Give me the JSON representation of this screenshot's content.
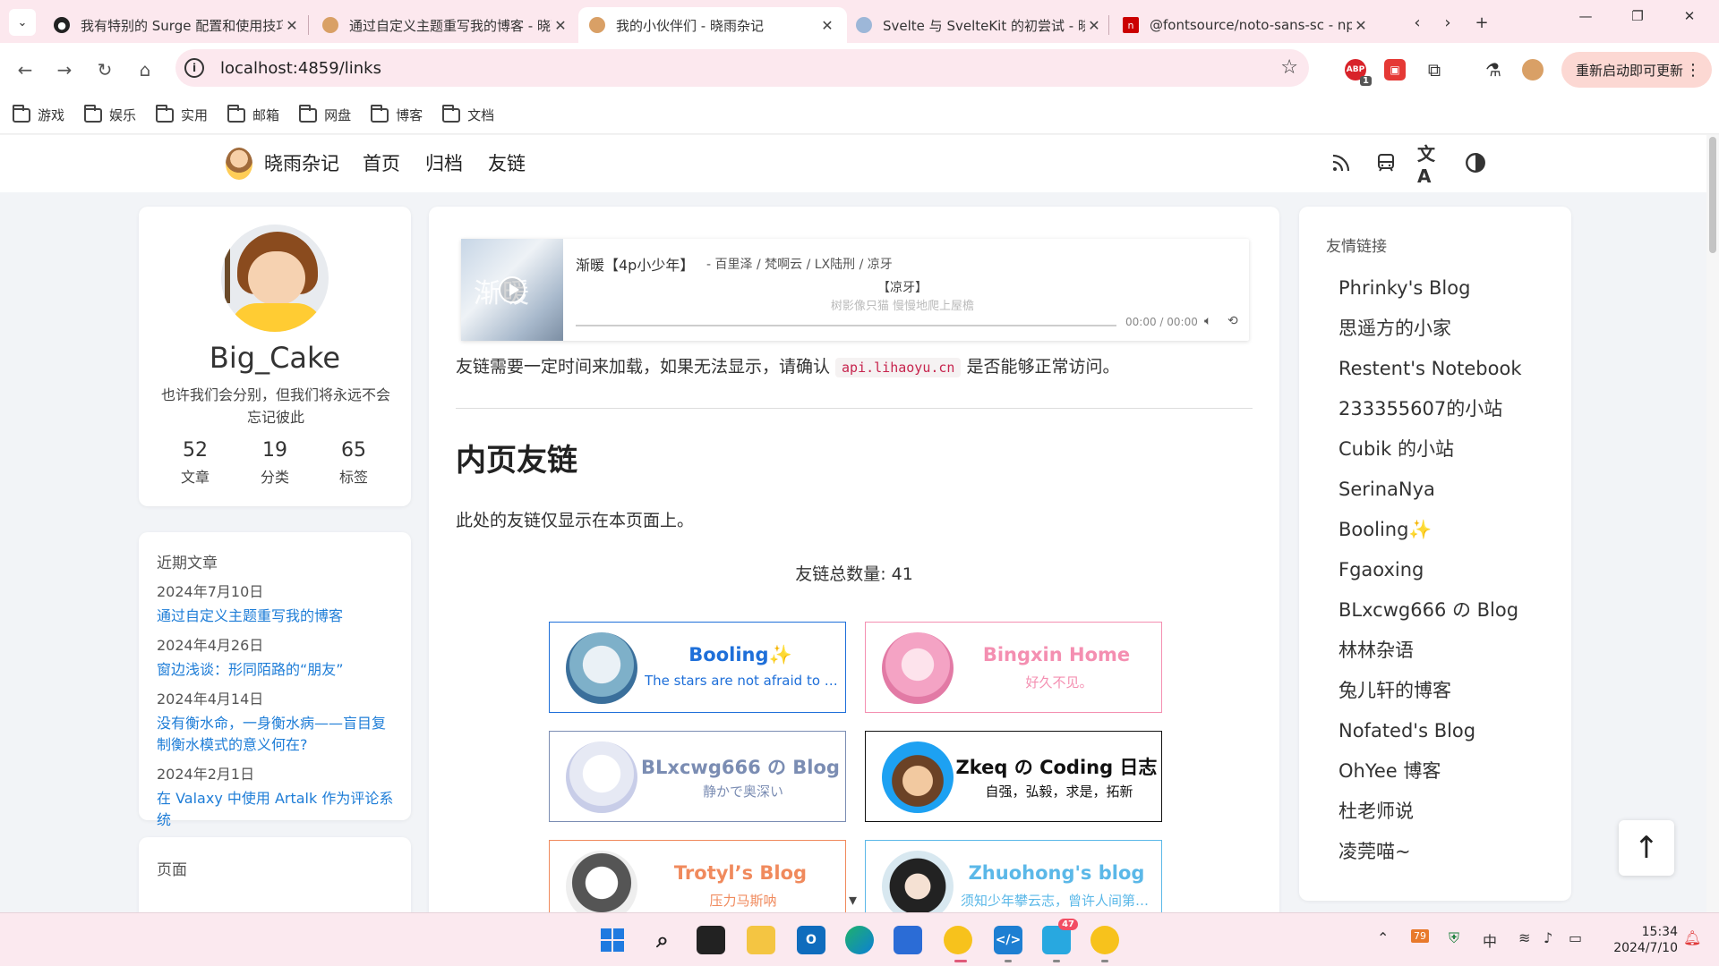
{
  "browser": {
    "tabs": [
      {
        "title": "我有特别的 Surge 配置和使用技巧",
        "fav_color": "#222222"
      },
      {
        "title": "通过自定义主题重写我的博客 - 晓雨杂记",
        "fav_color": "#d9a066"
      },
      {
        "title": "我的小伙伴们 - 晓雨杂记",
        "fav_color": "#d9a066"
      },
      {
        "title": "Svelte 与 SvelteKit 的初尝试 - 晓雨杂记",
        "fav_color": "#9db7d8"
      },
      {
        "title": "@fontsource/noto-sans-sc - npm",
        "fav_color": "#cb0000"
      }
    ],
    "url": "localhost:4859/links",
    "abp_count": "1",
    "update_label": "重新启动即可更新",
    "bookmarks": [
      "游戏",
      "娱乐",
      "实用",
      "邮箱",
      "网盘",
      "博客",
      "文档"
    ]
  },
  "site": {
    "brand": "晓雨杂记",
    "menu": [
      "首页",
      "归档",
      "友链"
    ]
  },
  "profile": {
    "name": "Big_Cake",
    "motto": "也许我们会分别，但我们将永远不会忘记彼此",
    "stats": [
      {
        "num": "52",
        "label": "文章"
      },
      {
        "num": "19",
        "label": "分类"
      },
      {
        "num": "65",
        "label": "标签"
      }
    ]
  },
  "recent": {
    "title": "近期文章",
    "posts": [
      {
        "date": "2024年7月10日",
        "title": "通过自定义主题重写我的博客"
      },
      {
        "date": "2024年4月26日",
        "title": "窗边浅谈：形同陌路的“朋友”"
      },
      {
        "date": "2024年4月14日",
        "title": "没有衡水命，一身衡水病——盲目复制衡水模式的意义何在?"
      },
      {
        "date": "2024年2月1日",
        "title": "在 Valaxy 中使用 Artalk 作为评论系统"
      }
    ],
    "next_title": "页面"
  },
  "player": {
    "cover_text": "渐暖",
    "song": "渐暖【4p小少年】",
    "artist": "- 百里泽 / 梵啊云 / LX陆刑 / 凉牙",
    "lyric": "【凉牙】",
    "lyric_next": "树影像只猫 慢慢地爬上屋檐",
    "time": "00:00 / 00:00",
    "progress": 0
  },
  "content": {
    "notice_before": "友链需要一定时间来加载，如果无法显示，请确认",
    "notice_code": "api.lihaoyu.cn",
    "notice_after": "是否能够正常访问。",
    "heading": "内页友链",
    "description": "此处的友链仅显示在本页面上。",
    "count_label": "友链总数量: 41"
  },
  "friend_cards": [
    {
      "name": "Booling✨",
      "desc": "The stars are not afraid to appear like fireflies.",
      "color": "#1e6fd9"
    },
    {
      "name": "Bingxin Home",
      "desc": "好久不见。",
      "color": "#f48fb1"
    },
    {
      "name": "BLxcwg666 の Blog",
      "desc": "静かで奥深い",
      "color": "#7b8db3"
    },
    {
      "name": "Zkeq の Coding 日志",
      "desc": "自强，弘毅，求是，拓新",
      "color": "#111111"
    },
    {
      "name": "Trotyl’s Blog",
      "desc": "压力马斯呐",
      "color": "#f08a5d"
    },
    {
      "name": "Zhuohong's blog",
      "desc": "须知少年攀云志，曾许人间第一流",
      "color": "#5bb8e8"
    }
  ],
  "friends_sidebar": {
    "title": "友情链接",
    "items": [
      "Phrinky's Blog",
      "思遥方的小家",
      "Restent's Notebook",
      "233355607的小站",
      "Cubik 的小站",
      "SerinaNya",
      "Booling✨",
      "Fgaoxing",
      "BLxcwg666 の Blog",
      "林林杂语",
      "兔儿轩的博客",
      "Nofated's Blog",
      "OhYee 博客",
      "杜老师说",
      "凌莞喵~"
    ]
  },
  "taskbar": {
    "tray_badge": "79",
    "ime": "中",
    "time": "15:34",
    "date": "2024/7/10",
    "feishu_badge": "47"
  }
}
